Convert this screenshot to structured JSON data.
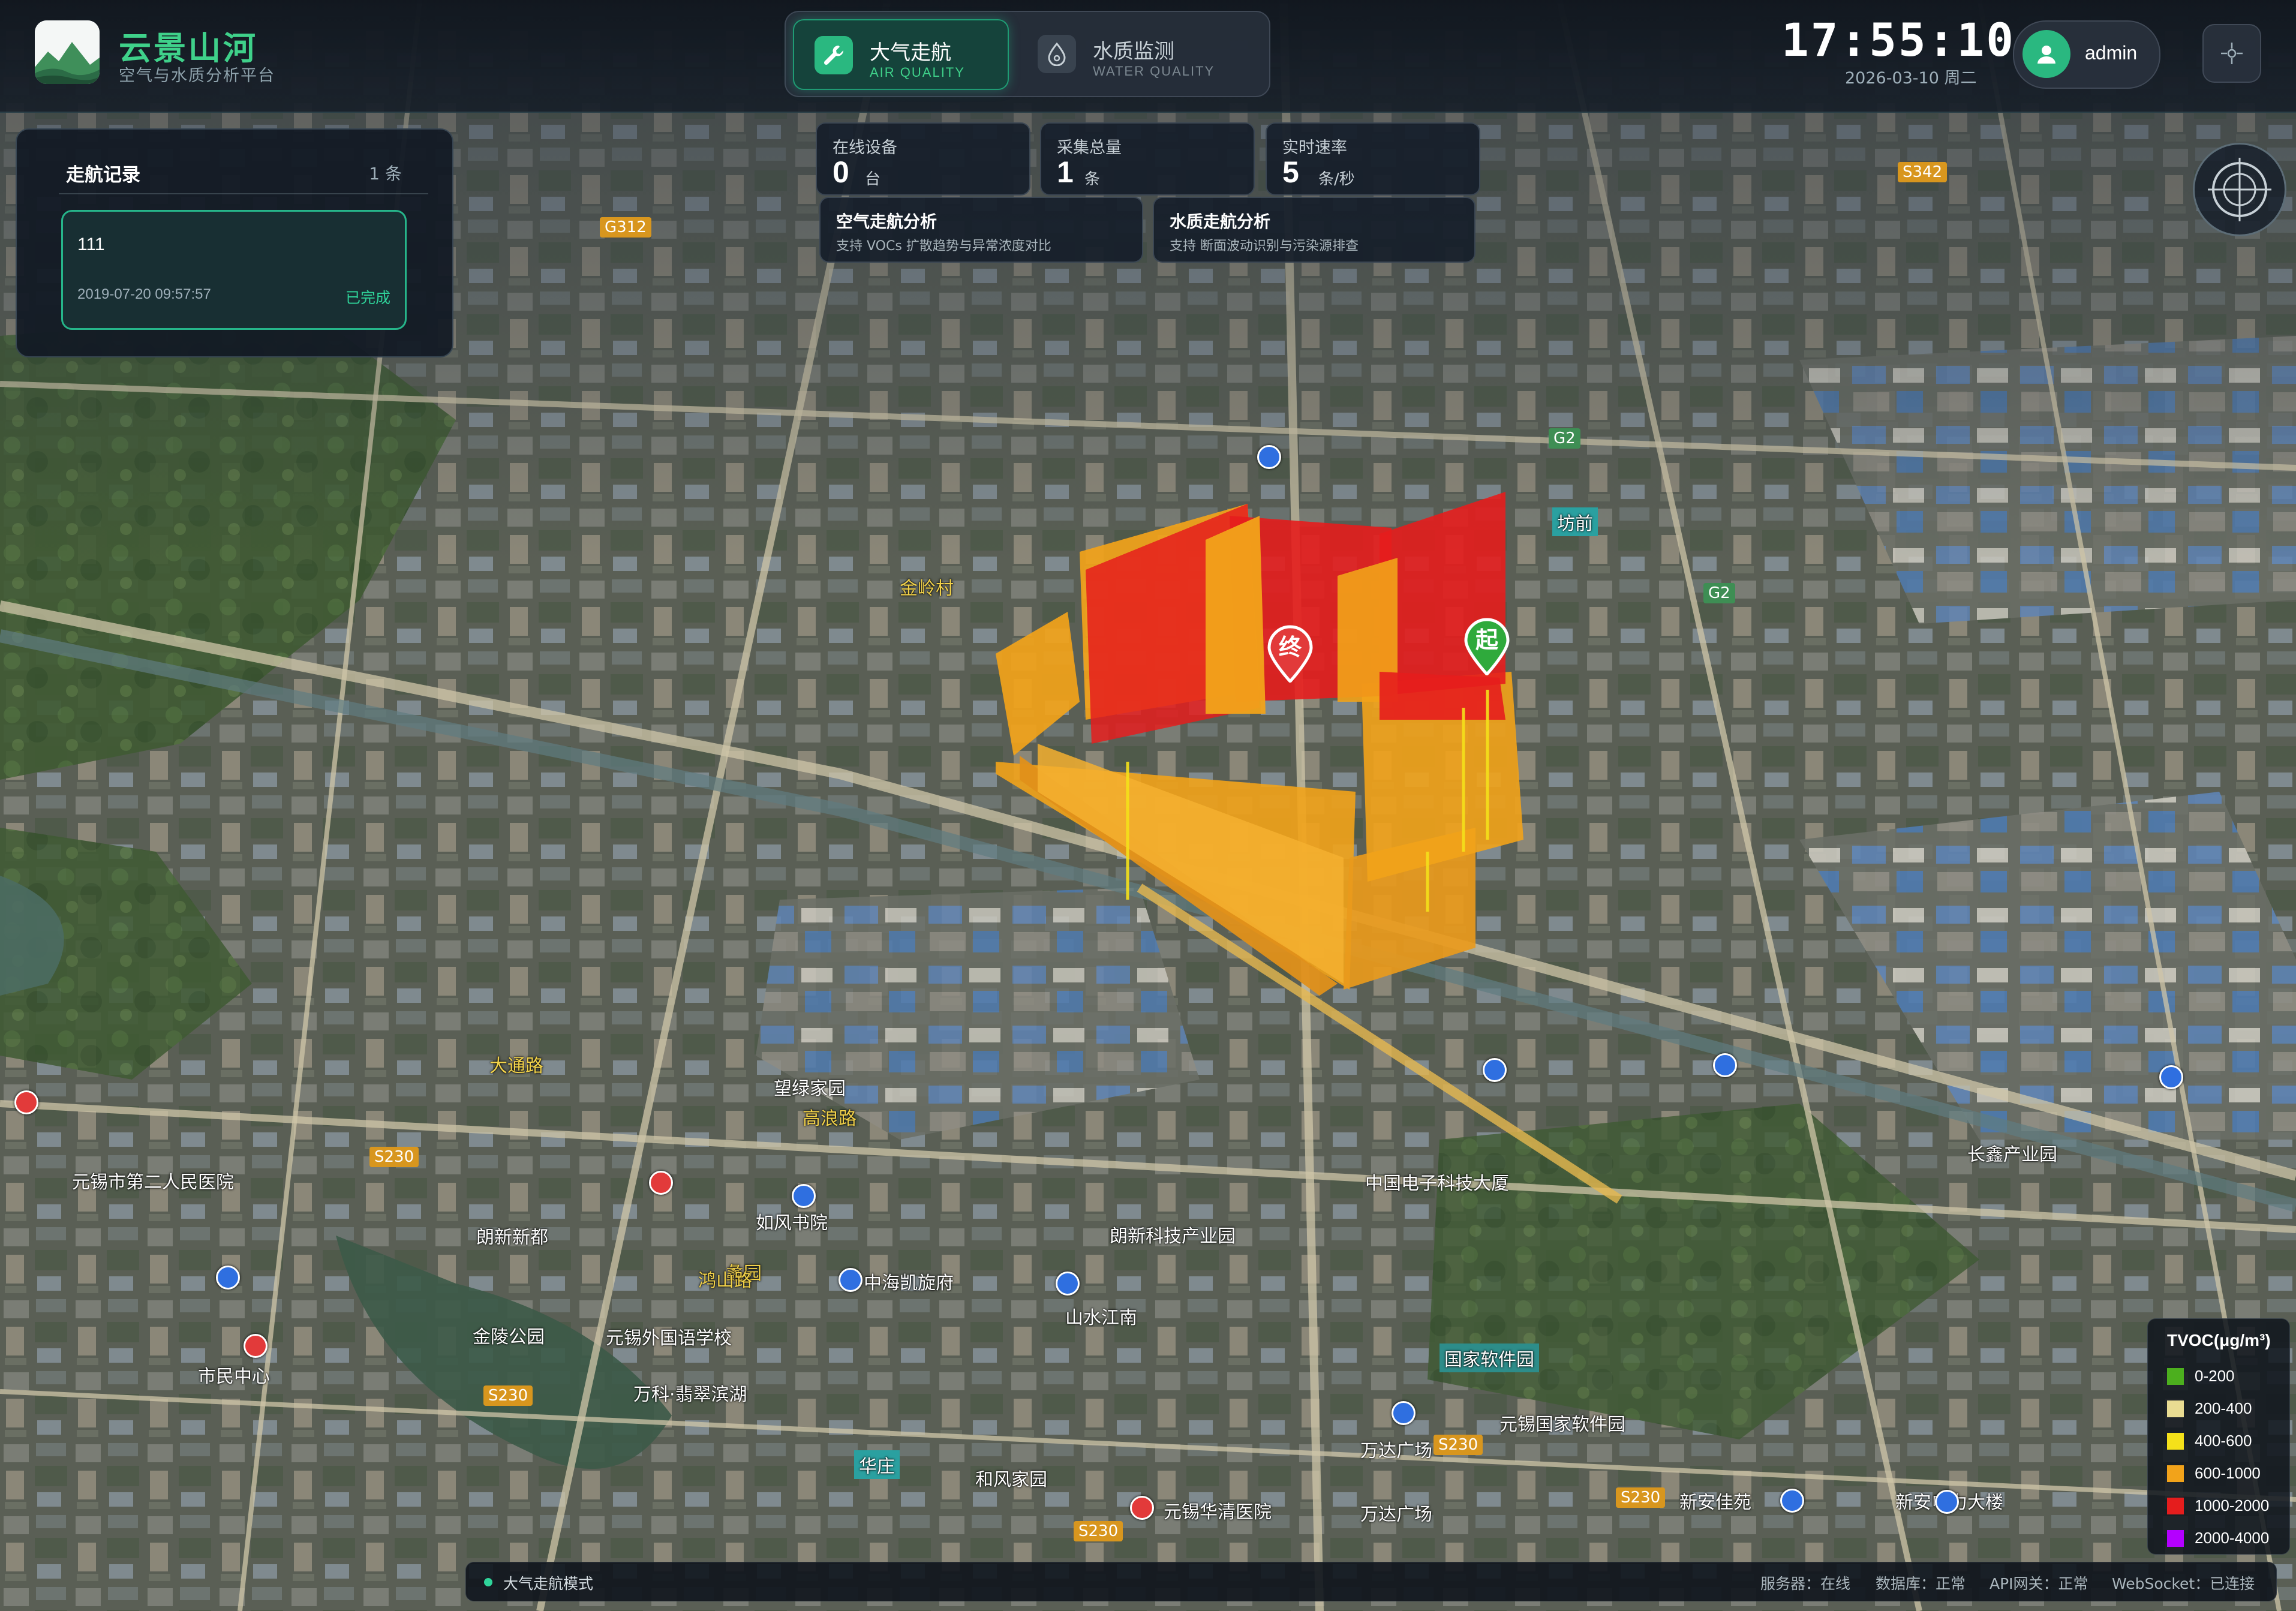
{
  "header": {
    "app_title": "云景山河",
    "app_subtitle": "空气与水质分析平台",
    "tabs": [
      {
        "label": "大气走航",
        "sublabel": "AIR QUALITY",
        "active": true,
        "icon": "wrench-icon"
      },
      {
        "label": "水质监测",
        "sublabel": "WATER QUALITY",
        "active": false,
        "icon": "water-drop-icon"
      }
    ],
    "clock": "17:55:10",
    "date": "2026-03-10 周二",
    "username": "admin",
    "settings_icon": "crosshair-icon"
  },
  "record_panel": {
    "title": "走航记录",
    "count": "1 条",
    "records": [
      {
        "name": "111",
        "time": "2019-07-20 09:57:57",
        "status": "已完成"
      }
    ]
  },
  "stats": [
    {
      "label": "在线设备",
      "value": "0",
      "unit": "台"
    },
    {
      "label": "采集总量",
      "value": "1",
      "unit": "条"
    },
    {
      "label": "实时速率",
      "value": "5",
      "unit": "条/秒"
    }
  ],
  "analysis": [
    {
      "title": "空气走航分析",
      "desc": "支持 VOCs 扩散趋势与异常浓度对比"
    },
    {
      "title": "水质走航分析",
      "desc": "支持 断面波动识别与污染源排查"
    }
  ],
  "route_markers": {
    "end": "终",
    "start": "起"
  },
  "legend": {
    "title": "TVOC(μg/m³)",
    "items": [
      {
        "label": "0-200",
        "color": "#4caf1e"
      },
      {
        "label": "200-400",
        "color": "#e9dc92"
      },
      {
        "label": "400-600",
        "color": "#f5e11a"
      },
      {
        "label": "600-1000",
        "color": "#f2a31a"
      },
      {
        "label": "1000-2000",
        "color": "#e51d1d"
      },
      {
        "label": "2000-4000",
        "color": "#b400ff"
      }
    ]
  },
  "status_bar": {
    "mode": "大气走航模式",
    "server": "服务器：在线",
    "database": "数据库：正常",
    "api_gateway": "API网关：正常",
    "websocket": "WebSocket：已连接"
  },
  "map_labels": [
    "元锡华清医院",
    "万达广场",
    "国家软件园",
    "新安电力大楼",
    "新安佳苑",
    "朗新科技产业园",
    "中海凯旋府",
    "山水江南",
    "如风书院",
    "金陵公园",
    "元锡外国语学校",
    "蠡园",
    "元锡市第二人民医院",
    "高浪路",
    "华庄",
    "和风家园",
    "望绿家园",
    "市民中心",
    "鸿山路",
    "坊前",
    "金岭村",
    "元锡国家软件园",
    "万科·翡翠滨湖",
    "万达广场",
    "大通路",
    "朗新新都",
    "中国电子科技大厦",
    "长鑫产业园",
    "S230",
    "G2",
    "S342",
    "G312"
  ]
}
